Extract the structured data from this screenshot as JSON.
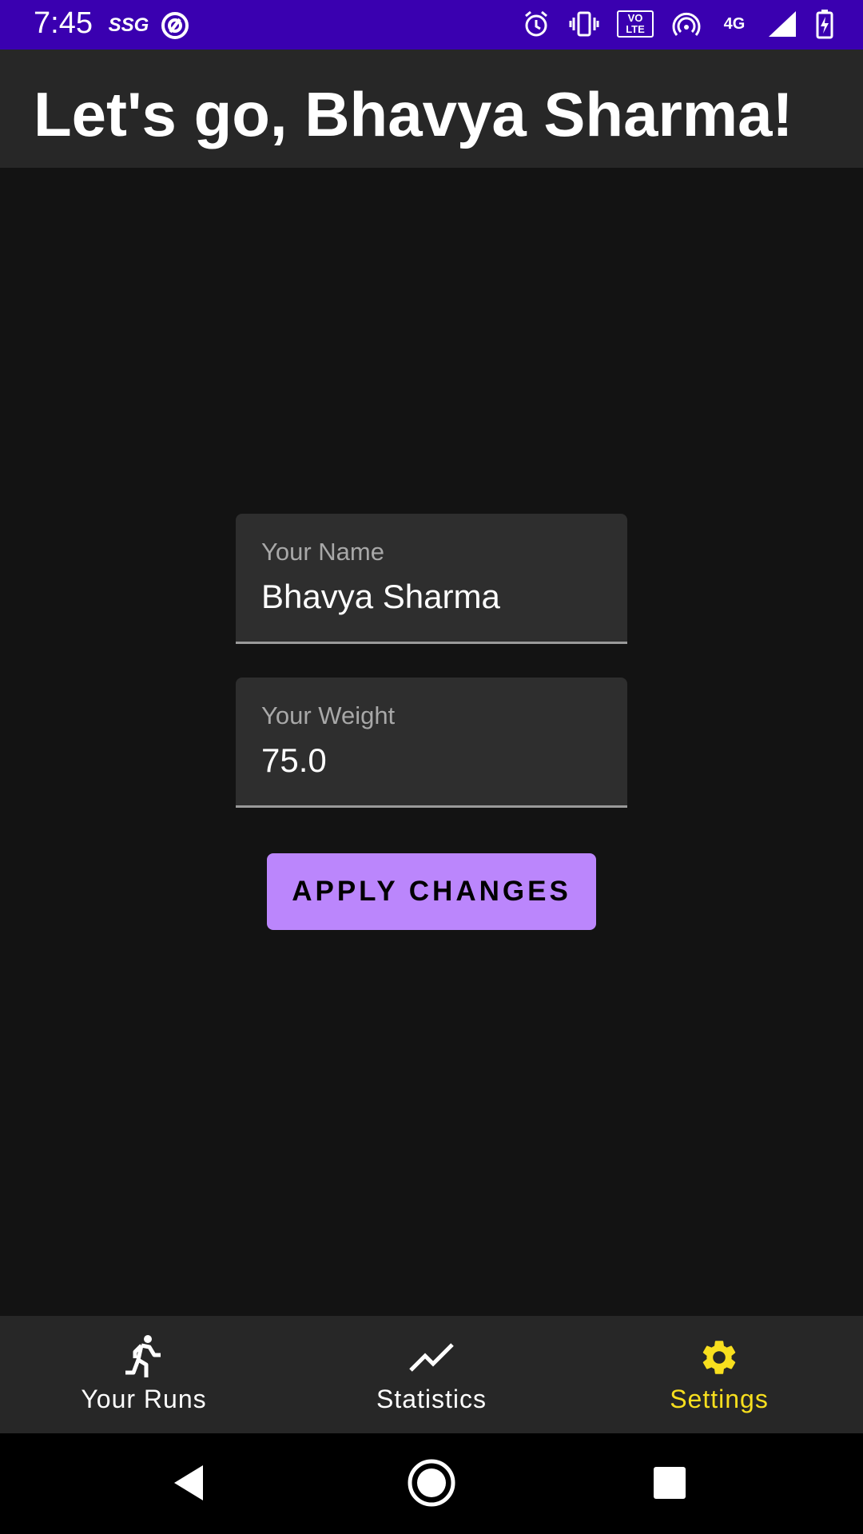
{
  "status_bar": {
    "time": "7:45",
    "carrier_badge": "SSG",
    "volte": "VO LTE",
    "network": "4G",
    "background_color": "#3a00b0",
    "icons": [
      "ssg-icon",
      "ring-icon",
      "alarm-icon",
      "vibrate-icon",
      "volte-icon",
      "hotspot-icon",
      "4g-icon",
      "signal-icon",
      "battery-charging-icon"
    ]
  },
  "app_bar": {
    "title": "Let's go, Bhavya Sharma!"
  },
  "form": {
    "name_label": "Your Name",
    "name_value": "Bhavya Sharma",
    "weight_label": "Your Weight",
    "weight_value": "75.0",
    "apply_label": "APPLY CHANGES",
    "apply_color": "#bb86fc"
  },
  "bottom_nav": {
    "items": [
      {
        "label": "Your Runs",
        "icon": "runner-icon"
      },
      {
        "label": "Statistics",
        "icon": "trending-line-icon"
      },
      {
        "label": "Settings",
        "icon": "gear-icon",
        "active": true
      }
    ],
    "active_color": "#f8df1e"
  },
  "system_nav": {
    "buttons": [
      "back-icon",
      "home-icon",
      "recents-icon"
    ]
  }
}
